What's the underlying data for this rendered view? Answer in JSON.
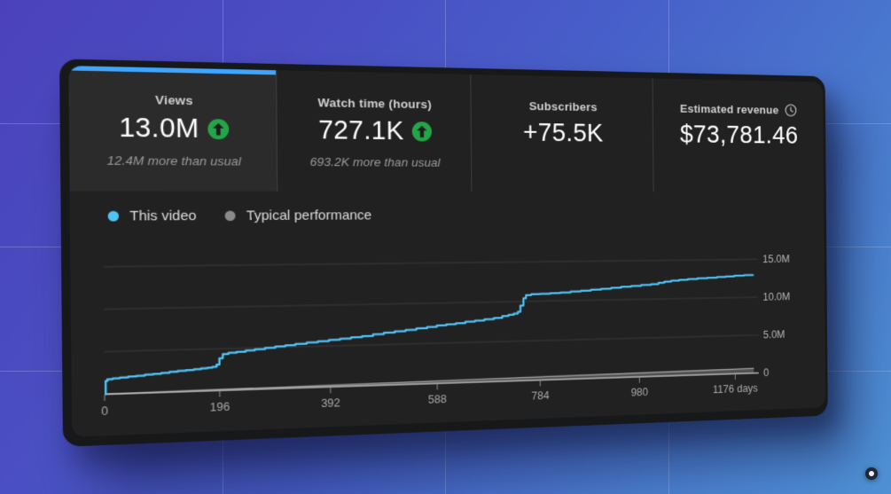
{
  "background": {
    "gradient_start": "#4b42bb",
    "gradient_end": "#4e90d3",
    "grid_color": "rgba(218,230,255,0.24)"
  },
  "panel": {
    "accent_color": "#3ea6ff",
    "tabs": [
      {
        "id": "views",
        "label": "Views",
        "value": "13.0M",
        "trend_icon": "up-arrow",
        "note": "12.4M more than usual",
        "selected": true
      },
      {
        "id": "watch-time",
        "label": "Watch time (hours)",
        "value": "727.1K",
        "trend_icon": "up-arrow",
        "note": "693.2K more than usual",
        "selected": false
      },
      {
        "id": "subscribers",
        "label": "Subscribers",
        "value": "+75.5K",
        "selected": false
      },
      {
        "id": "estimated-revenue",
        "label": "Estimated revenue",
        "value": "$73,781.46",
        "info_icon": "clock",
        "selected": false
      }
    ],
    "legend": [
      {
        "label": "This video",
        "color": "#4fc3f7"
      },
      {
        "label": "Typical performance",
        "color": "#8a8a8a"
      }
    ],
    "trend_badge_color": "#23a648"
  },
  "chart_data": {
    "type": "line",
    "title": "Cumulative video views vs typical performance",
    "x_unit": "days",
    "xlim": [
      0,
      1225
    ],
    "ylim": [
      0,
      16.5
    ],
    "x_ticks": [
      0,
      196,
      392,
      588,
      784,
      980,
      1176
    ],
    "x_last_tick_label": "1176 days",
    "y_tick_values": [
      15,
      10,
      5,
      0
    ],
    "y_tick_labels": [
      "15.0M",
      "10.0M",
      "5.0M",
      "0"
    ],
    "grid": true,
    "legend_position": "top-left",
    "series": [
      {
        "name": "This video",
        "color": "#4fc3f7",
        "step": true,
        "points_millions": [
          [
            0,
            0
          ],
          [
            2,
            1.55
          ],
          [
            5,
            1.75
          ],
          [
            14,
            1.83
          ],
          [
            26,
            1.9
          ],
          [
            40,
            1.98
          ],
          [
            54,
            2.06
          ],
          [
            68,
            2.14
          ],
          [
            82,
            2.22
          ],
          [
            96,
            2.3
          ],
          [
            110,
            2.4
          ],
          [
            124,
            2.48
          ],
          [
            138,
            2.55
          ],
          [
            152,
            2.62
          ],
          [
            164,
            2.7
          ],
          [
            175,
            2.77
          ],
          [
            184,
            2.85
          ],
          [
            191,
            3.1
          ],
          [
            196,
            3.85
          ],
          [
            202,
            4.35
          ],
          [
            212,
            4.48
          ],
          [
            226,
            4.58
          ],
          [
            242,
            4.7
          ],
          [
            258,
            4.82
          ],
          [
            276,
            4.95
          ],
          [
            294,
            5.1
          ],
          [
            312,
            5.22
          ],
          [
            330,
            5.35
          ],
          [
            350,
            5.48
          ],
          [
            370,
            5.6
          ],
          [
            390,
            5.73
          ],
          [
            410,
            5.85
          ],
          [
            430,
            5.98
          ],
          [
            450,
            6.1
          ],
          [
            470,
            6.3
          ],
          [
            490,
            6.45
          ],
          [
            510,
            6.6
          ],
          [
            530,
            6.75
          ],
          [
            550,
            6.9
          ],
          [
            570,
            7.05
          ],
          [
            588,
            7.2
          ],
          [
            606,
            7.32
          ],
          [
            624,
            7.45
          ],
          [
            642,
            7.6
          ],
          [
            660,
            7.72
          ],
          [
            678,
            7.85
          ],
          [
            696,
            8.0
          ],
          [
            712,
            8.2
          ],
          [
            724,
            8.35
          ],
          [
            734,
            8.5
          ],
          [
            742,
            8.7
          ],
          [
            747,
            9.5
          ],
          [
            753,
            10.4
          ],
          [
            758,
            10.8
          ],
          [
            768,
            10.9
          ],
          [
            785,
            10.95
          ],
          [
            805,
            11.0
          ],
          [
            825,
            11.05
          ],
          [
            845,
            11.15
          ],
          [
            865,
            11.25
          ],
          [
            885,
            11.35
          ],
          [
            905,
            11.45
          ],
          [
            925,
            11.55
          ],
          [
            945,
            11.65
          ],
          [
            965,
            11.75
          ],
          [
            985,
            11.85
          ],
          [
            1005,
            11.95
          ],
          [
            1020,
            12.1
          ],
          [
            1032,
            12.25
          ],
          [
            1046,
            12.35
          ],
          [
            1062,
            12.45
          ],
          [
            1080,
            12.52
          ],
          [
            1100,
            12.6
          ],
          [
            1120,
            12.67
          ],
          [
            1140,
            12.74
          ],
          [
            1158,
            12.8
          ],
          [
            1176,
            12.88
          ],
          [
            1196,
            12.95
          ],
          [
            1215,
            13.0
          ]
        ]
      },
      {
        "name": "Typical performance",
        "color": "#a0a0a0",
        "step": false,
        "points_millions": [
          [
            0,
            0
          ],
          [
            1215,
            0.62
          ]
        ]
      }
    ]
  },
  "cursor_indicator": {
    "shape": "circle"
  }
}
